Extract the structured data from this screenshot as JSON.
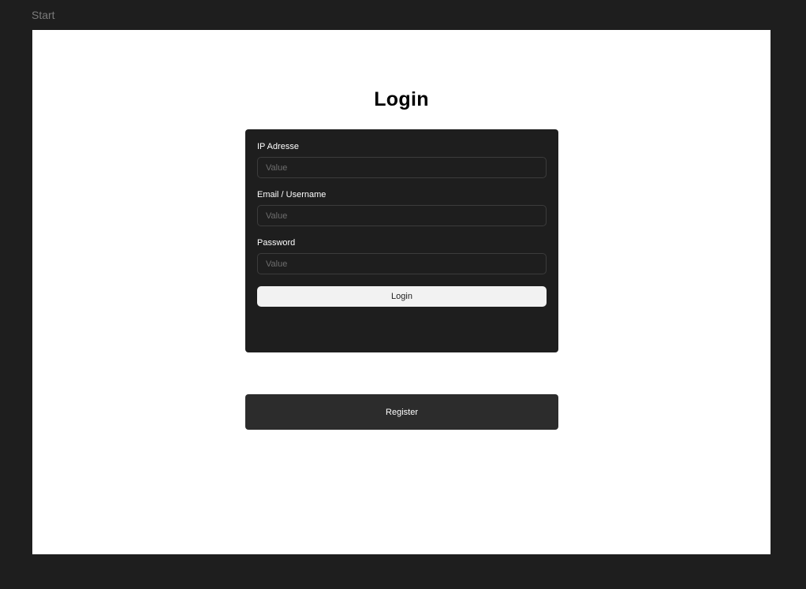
{
  "frame": {
    "label": "Start"
  },
  "main": {
    "title": "Login"
  },
  "login_form": {
    "fields": [
      {
        "label": "IP Adresse",
        "placeholder": "Value",
        "value": ""
      },
      {
        "label": "Email / Username",
        "placeholder": "Value",
        "value": ""
      },
      {
        "label": "Password",
        "placeholder": "Value",
        "value": ""
      }
    ],
    "submit_label": "Login"
  },
  "register": {
    "label": "Register"
  },
  "colors": {
    "canvas_background": "#1e1e1e",
    "frame_background": "#ffffff",
    "card_background": "#1e1e1e",
    "input_border": "#3c3c3c",
    "login_button_background": "#f2f2f2",
    "register_button_background": "#2c2c2c"
  }
}
